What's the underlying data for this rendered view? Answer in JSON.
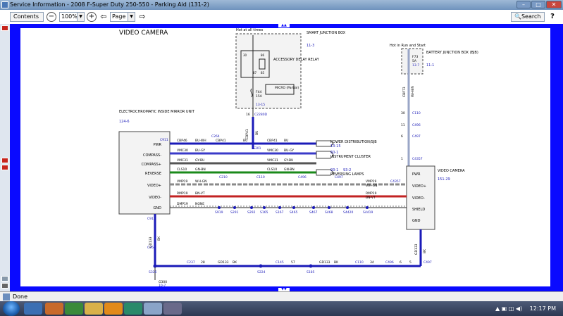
{
  "window": {
    "title": "Service Information - 2008 F-Super Duty 250-550 - Parking Aid (131-2)"
  },
  "toolbar": {
    "contents_label": "Contents",
    "zoom_value": "100%",
    "page_value": "Page 2",
    "search_label": "Search"
  },
  "status": {
    "text": "Done"
  },
  "clock": "12:17 PM",
  "diagram": {
    "title": "VIDEO CAMERA",
    "hot_label": "Hot at all times",
    "sjb": {
      "name": "SMART\nJUNCTION\nBOX",
      "ref": "11-3"
    },
    "relay": {
      "pin30": "30",
      "pin86": "86",
      "pin87": "87",
      "pin85": "85",
      "name": "ACCESSORY\nDELAY\nRELAY"
    },
    "micro": {
      "name": "MICRO\n(Partial)"
    },
    "fuse1": {
      "name": "F44",
      "rating": "15A"
    },
    "sjb_ref2": "13-15",
    "c2280": {
      "pin": "16",
      "name": "C2280D"
    },
    "hot_run": "Hot in Run and Start",
    "bjb": {
      "name": "BATTERY\nJUNCTION\nBOX (BJB)",
      "ref": "11-1"
    },
    "fuse2": {
      "name": "F73",
      "rating": "5A",
      "ref": "13-7"
    },
    "mirror": {
      "name": "ELECTROCHROMATIC\nINSIDE MIRROR\nUNIT",
      "ref": "124-6"
    },
    "mirror_pins": [
      "PWR",
      "COMPASS-",
      "COMPASS+",
      "REVERSE",
      "VIDEO+",
      "VIDEO-",
      "GND"
    ],
    "camera": {
      "name": "VIDEO\nCAMERA",
      "ref": "151-29"
    },
    "camera_pins": [
      "PWR",
      "VIDEO+",
      "VIDEO-",
      "SHIELD",
      "GND"
    ],
    "wires": [
      {
        "c1": "CBP46",
        "col1": "BU-WH",
        "c2": "CBP41",
        "col2": "BU",
        "c3": "CBP41",
        "col3": "BU",
        "dest": "POWER DISTRIBUTION/SJB",
        "destref": "13-15",
        "color": "#1a1ab8"
      },
      {
        "c1": "VMC30",
        "col1": "BU-GY",
        "c2": "VMC30",
        "col2": "BU-GY",
        "dest": "INSTRUMENT CLUSTER",
        "destref": "60-1",
        "color": "#3a3ac8"
      },
      {
        "c1": "VMC31",
        "col1": "GY-BU",
        "c2": "VMC31",
        "col2": "GY-BU",
        "color": "#555555"
      },
      {
        "c1": "CLS10",
        "col1": "GN-BN",
        "c2": "CLS10",
        "col2": "GN-BN",
        "dest": "REVERSING LAMPS",
        "destref1": "93-1",
        "destref2": "93-2",
        "color": "#1a8a1a"
      },
      {
        "c1": "VMP19",
        "col1": "WH-GN",
        "c2": "VMP19",
        "col2": "WH-GN",
        "color": "#8a8a8a"
      },
      {
        "c1": "RMP19",
        "col1": "BN-VT",
        "c2": "RMP19",
        "col2": "BN-VT",
        "color": "#c22222"
      },
      {
        "c1": "DMP19",
        "col1": "NONE",
        "color": "#222222"
      }
    ],
    "connectors": {
      "c911": "C911",
      "c264": "C264",
      "c210": "C210",
      "c110": "C110",
      "c496": "C496",
      "c497": "C497",
      "c4357": "C4357",
      "s301": "S301"
    },
    "splices": [
      "S919",
      "S291",
      "S292",
      "S165",
      "S167",
      "S465",
      "S467",
      "S468",
      "S4420",
      "S4419"
    ],
    "gnd_wire": {
      "circuit": "GD133",
      "color": "BK"
    },
    "bottom": {
      "c237": "C237",
      "c145": "C145",
      "c110b": "C110",
      "c496b": "C496",
      "c497b": "C497",
      "s326": "S326",
      "s224": "S224",
      "s185": "S185",
      "g300": "G300",
      "g300ref": "10-7",
      "pins": [
        "28",
        "57",
        "34",
        "6",
        "5"
      ]
    },
    "vert_wire": {
      "circuit": "CBP73",
      "color": "WH-BN",
      "c110": "C110",
      "c496": "C496",
      "c497": "C497",
      "c4357": "C4357",
      "pins": [
        "30",
        "11",
        "6",
        "1"
      ]
    }
  }
}
